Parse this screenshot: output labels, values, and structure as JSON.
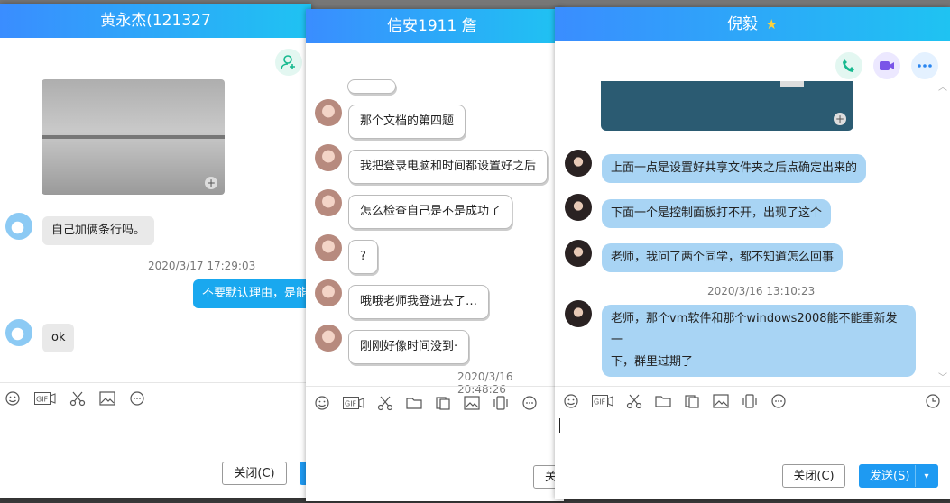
{
  "win1": {
    "title": "黄永杰(121327",
    "msg_1": "自己加俩条行吗。",
    "time_1": "2020/3/17 17:29:03",
    "msg_2": "不要默认理由，是能",
    "msg_3": "ok",
    "close_label": "关闭(C)"
  },
  "win2": {
    "title": "信安1911 詹",
    "msgs": [
      "那个文档的第四题",
      "我把登录电脑和时间都设置好之后",
      "怎么检查自己是不是成功了",
      "?",
      "哦哦老师我登进去了…",
      "刚刚好像时间没到·"
    ],
    "time_1": "2020/3/16 20:48:26",
    "close_label": "关"
  },
  "win3": {
    "title": "倪毅",
    "msgs": [
      "上面一点是设置好共享文件夹之后点确定出来的",
      "下面一个是控制面板打不开，出现了这个",
      "老师，我问了两个同学，都不知道怎么回事"
    ],
    "time_1": "2020/3/16 13:10:23",
    "msg_4a": "老师，那个vm软件和那个windows2008能不能重新发一",
    "msg_4b": "下，群里过期了",
    "close_label": "关闭(C)",
    "send_label": "发送(S)"
  },
  "toolbar_icons": [
    "emoji-icon",
    "gif-icon",
    "scissors-icon",
    "folder-icon",
    "file-icon",
    "image-icon",
    "shake-icon",
    "more-icon",
    "history-icon"
  ],
  "colors": {
    "title_start": "#3a8dff",
    "title_end": "#1fc3f2",
    "self_bubble": "#19a8ef",
    "other_bubble": "#a8d4f4",
    "send_button": "#1e9af2"
  }
}
